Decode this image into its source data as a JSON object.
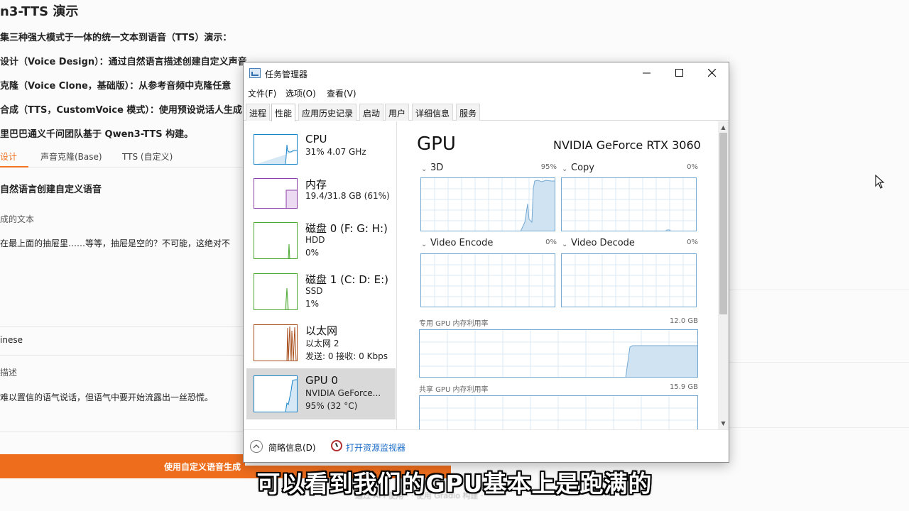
{
  "background_page": {
    "title": "n3-TTS 演示",
    "lines": [
      "集三种强大模式于一体的统一文本到语音（TTS）演示：",
      "设计（Voice Design）：通过自然语言描述创建自定义声音",
      "克隆（Voice Clone，基础版）：从参考音频中克隆任意",
      "合成（TTS，CustomVoice 模式）：使用预设说话人生成",
      "里巴巴通义千问团队基于 Qwen3-TTS 构建。"
    ],
    "tabs": [
      "设计",
      "声音克隆(Base)",
      "TTS (自定义)"
    ],
    "section_heading": "自然语言创建自定义语音",
    "text_label": "成的文本",
    "text_value": "在最上面的抽屉里……等等，抽屉是空的？不可能，这绝对不",
    "language_value": "inese",
    "desc_label": "描述",
    "desc_value": "难以置信的语气说话，但语气中要开始流露出一丝恐慌。",
    "generate_button": "使用自定义语音生成",
    "footer_text": "通过 API 使用 ·  ·  使用 Gradio 构建 ·"
  },
  "window": {
    "title": "任务管理器",
    "menu": [
      "文件(F)",
      "选项(O)",
      "查看(V)"
    ],
    "tabs": [
      "进程",
      "性能",
      "应用历史记录",
      "启动",
      "用户",
      "详细信息",
      "服务"
    ],
    "active_tab": "性能"
  },
  "sidebar": [
    {
      "name": "CPU",
      "line1": "31% 4.07 GHz",
      "line2": "",
      "color": "#1a85c8"
    },
    {
      "name": "内存",
      "line1": "19.4/31.8 GB (61%)",
      "line2": "",
      "color": "#8e3fa7"
    },
    {
      "name": "磁盘 0 (F: G: H:)",
      "line1": "HDD",
      "line2": "0%",
      "color": "#4da832"
    },
    {
      "name": "磁盘 1 (C: D: E:)",
      "line1": "SSD",
      "line2": "1%",
      "color": "#4da832"
    },
    {
      "name": "以太网",
      "line1": "以太网 2",
      "line2": "发送: 0 接收: 0 Kbps",
      "color": "#a8501f"
    },
    {
      "name": "GPU 0",
      "line1": "NVIDIA GeForce...",
      "line2": "95% (32 °C)",
      "color": "#1a85c8"
    }
  ],
  "gpu_panel": {
    "title": "GPU",
    "model": "NVIDIA GeForce RTX 3060",
    "engines": [
      {
        "label": "3D",
        "pct": "95%"
      },
      {
        "label": "Copy",
        "pct": "0%"
      },
      {
        "label": "Video Encode",
        "pct": "0%"
      },
      {
        "label": "Video Decode",
        "pct": "0%"
      }
    ],
    "dedicated_label": "专用 GPU 内存利用率",
    "dedicated_value": "12.0 GB",
    "shared_label": "共享 GPU 内存利用率",
    "shared_value": "15.9 GB",
    "graph_color": "#74a9d3"
  },
  "bottom": {
    "fewer_details": "简略信息(D)",
    "resource_monitor": "打开资源监视器"
  },
  "subtitle": "可以看到我们的GPU基本上是跑满的"
}
